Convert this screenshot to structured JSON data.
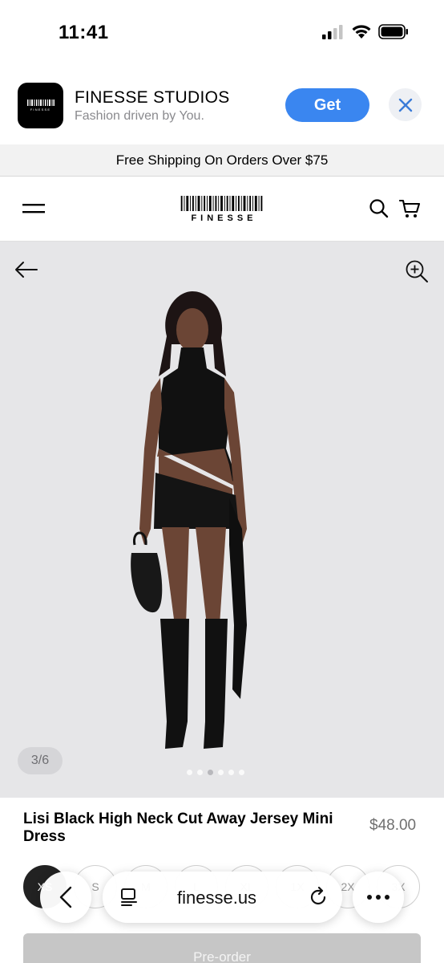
{
  "status_bar": {
    "time": "11:41"
  },
  "app_banner": {
    "app_name": "FINESSE STUDIOS",
    "tagline": "Fashion driven by You.",
    "get_label": "Get",
    "icon_text": "FINESSE"
  },
  "shipping_bar": {
    "text": "Free Shipping On Orders Over $75"
  },
  "header": {
    "logo_text": "FINESSE"
  },
  "gallery": {
    "counter": "3/6",
    "current_index": 3,
    "total": 6
  },
  "product": {
    "title": "Lisi Black High Neck Cut Away Jersey Mini Dress",
    "price": "$48.00"
  },
  "sizes": [
    {
      "label": "XS",
      "selected": true
    },
    {
      "label": "S",
      "selected": false
    },
    {
      "label": "M",
      "selected": false
    },
    {
      "label": "L",
      "selected": false
    },
    {
      "label": "XL",
      "selected": false
    },
    {
      "label": "1X",
      "selected": false
    },
    {
      "label": "2X",
      "selected": false
    },
    {
      "label": "3X",
      "selected": false
    }
  ],
  "browser": {
    "url": "finesse.us"
  },
  "preorder": {
    "label": "Pre-order"
  },
  "colors": {
    "get_button": "#3a86f0",
    "gallery_bg": "#e6e6e8",
    "preorder_bg": "#c6c6c6"
  }
}
